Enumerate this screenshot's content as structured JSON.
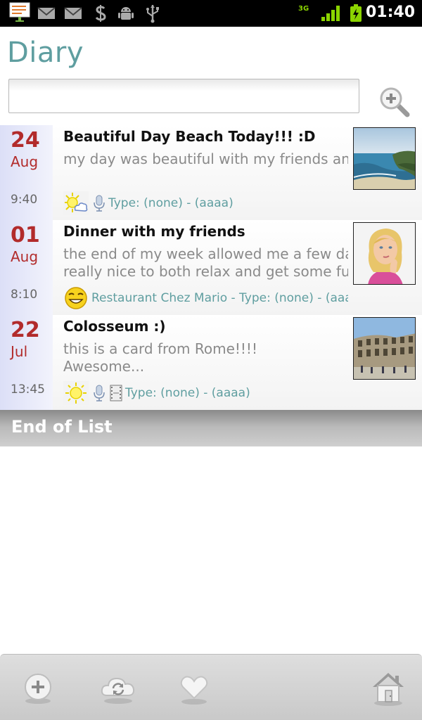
{
  "status_bar": {
    "time": "01:40",
    "network_label": "3G",
    "icons": [
      "notes-icon",
      "mail-icon",
      "mail-icon",
      "money-icon",
      "android-icon",
      "usb-icon",
      "network-3g-icon",
      "signal-icon",
      "battery-charging-icon"
    ]
  },
  "header": {
    "title": "Diary"
  },
  "search": {
    "placeholder": "",
    "value": "",
    "button_icon": "zoom-in-icon"
  },
  "entries": [
    {
      "day": "24",
      "month": "Aug",
      "time": "9:40",
      "title": "Beautiful Day Beach Today!!! :D",
      "body": "my day was beautiful with my friends and my",
      "meta": "Type: (none) - (aaaa)",
      "icons": [
        "weather-sun-cloud-icon",
        "microphone-icon"
      ],
      "thumbnail": "beach-photo"
    },
    {
      "day": "01",
      "month": "Aug",
      "time": "8:10",
      "title": "Dinner with my friends",
      "body": "the end of my week allowed me a few days off\nreally nice to both relax and get some fun...",
      "meta": "Restaurant Chez Mario - Type: (none) - (aaaa)",
      "icons": [
        "smiley-icon"
      ],
      "thumbnail": "woman-photo"
    },
    {
      "day": "22",
      "month": "Jul",
      "time": "13:45",
      "title": "Colosseum :)",
      "body": "this is a card from Rome!!!!\nAwesome...",
      "meta": "Type: (none) - (aaaa)",
      "icons": [
        "weather-sun-icon",
        "microphone-icon",
        "film-icon"
      ],
      "thumbnail": "colosseum-photo"
    }
  ],
  "end_of_list": "End of List",
  "toolbar": {
    "buttons": [
      "add-icon",
      "sync-icon",
      "favorites-icon",
      "home-icon"
    ]
  },
  "colors": {
    "accent": "#5f9ea0",
    "date": "#b22b2b"
  }
}
